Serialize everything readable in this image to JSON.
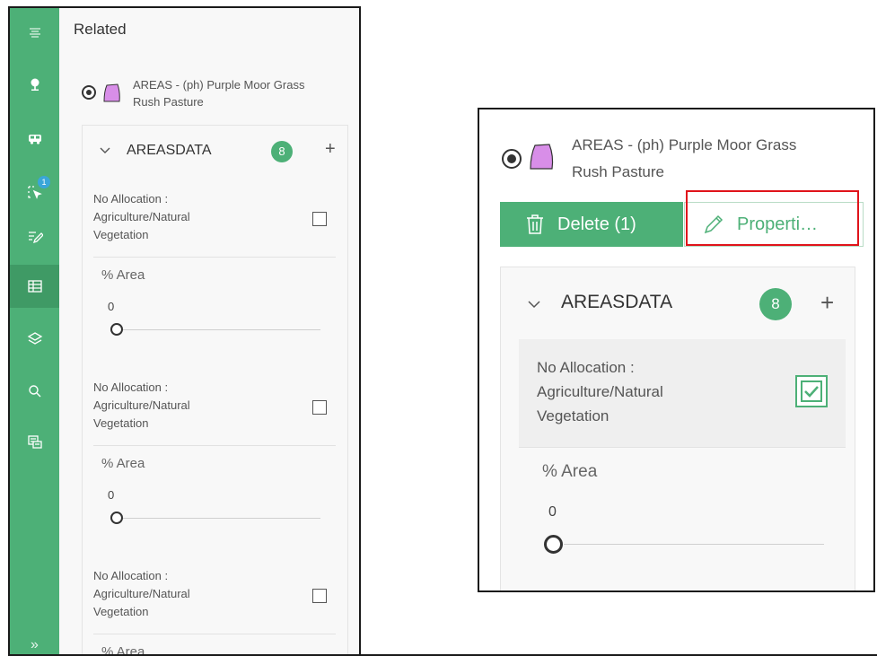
{
  "left_panel": {
    "title": "Related",
    "nav_rail": {
      "items": [
        {
          "icon": "menu-lines-icon"
        },
        {
          "icon": "map-pin-icon"
        },
        {
          "icon": "bus-icon"
        },
        {
          "icon": "select-cursor-icon",
          "badge": "1"
        },
        {
          "icon": "edit-lines-icon"
        },
        {
          "icon": "table-icon",
          "active": true
        },
        {
          "icon": "layers-icon"
        },
        {
          "icon": "search-icon"
        },
        {
          "icon": "chat-icon"
        },
        {
          "icon": "expand-chevrons-icon",
          "label": "»"
        }
      ]
    },
    "feature": {
      "line1": "AREAS - (ph) Purple Moor Grass",
      "line2": "Rush Pasture",
      "shape_color": "#d88ee8"
    },
    "section": {
      "title": "AREASDATA",
      "count": "8",
      "add": "+"
    },
    "rows": [
      {
        "alloc_l1": "No Allocation :",
        "alloc_l2": "Agriculture/Natural",
        "alloc_l3": "Vegetation",
        "area_label": "% Area",
        "area_value": "0"
      },
      {
        "alloc_l1": "No Allocation :",
        "alloc_l2": "Agriculture/Natural",
        "alloc_l3": "Vegetation",
        "area_label": "% Area",
        "area_value": "0"
      },
      {
        "alloc_l1": "No Allocation :",
        "alloc_l2": "Agriculture/Natural",
        "alloc_l3": "Vegetation",
        "area_label": "% Area"
      }
    ]
  },
  "right_panel": {
    "feature": {
      "line1": "AREAS - (ph) Purple Moor Grass",
      "line2": "Rush Pasture",
      "shape_color": "#d88ee8"
    },
    "delete_label": "Delete (1)",
    "properties_label": "Properti…",
    "section": {
      "title": "AREASDATA",
      "count": "8",
      "add": "+"
    },
    "row": {
      "alloc_l1": "No Allocation :",
      "alloc_l2": "Agriculture/Natural",
      "alloc_l3": "Vegetation",
      "checked": true,
      "area_label": "% Area",
      "area_value": "0"
    }
  },
  "colors": {
    "accent_green": "#4db077",
    "highlight_red": "#e0141b"
  }
}
